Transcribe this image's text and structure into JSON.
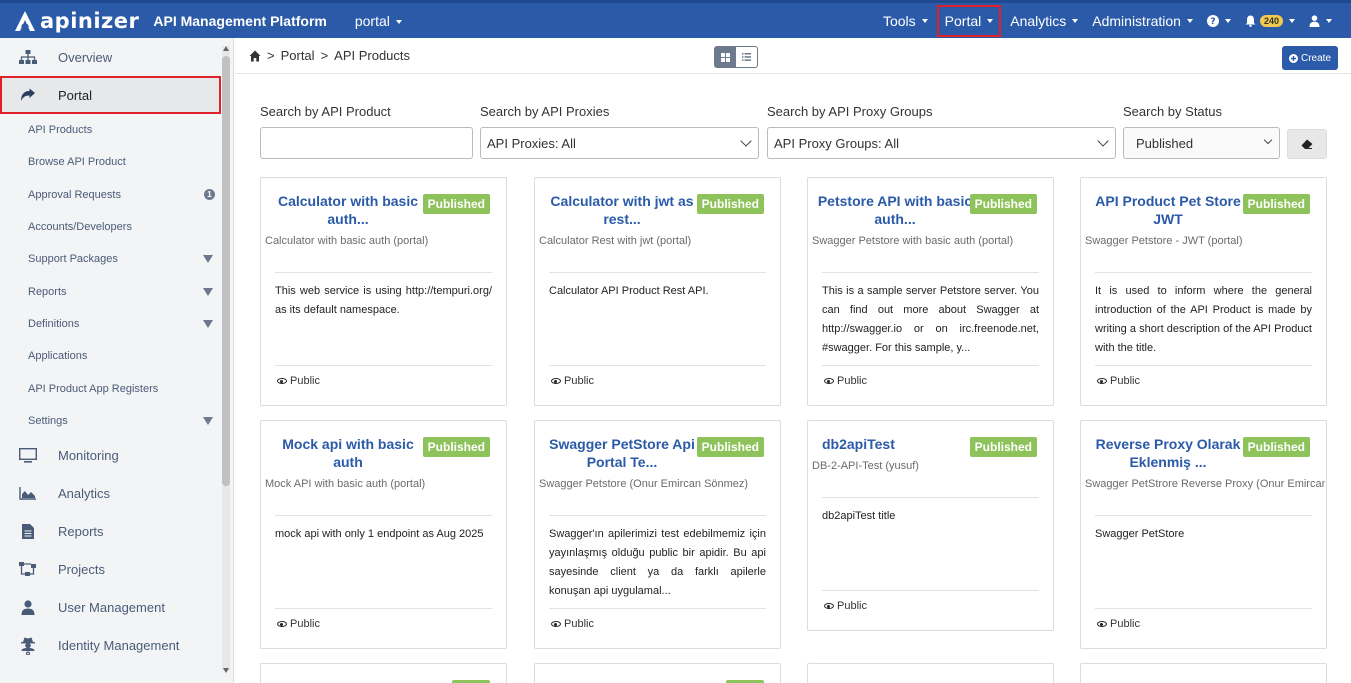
{
  "header": {
    "logo_text": "apinizer",
    "platform_title": "API Management Platform",
    "project_select": "portal",
    "nav": [
      {
        "label": "Tools"
      },
      {
        "label": "Portal"
      },
      {
        "label": "Analytics"
      },
      {
        "label": "Administration"
      }
    ],
    "notification_count": "240"
  },
  "sidebar": {
    "main_top": [
      {
        "label": "Overview",
        "icon": "sitemap-icon"
      },
      {
        "label": "Portal",
        "icon": "share-arrow-icon"
      }
    ],
    "portal_sub": [
      {
        "label": "API Products"
      },
      {
        "label": "Browse API Product"
      },
      {
        "label": "Approval Requests",
        "count": "1"
      },
      {
        "label": "Accounts/Developers"
      },
      {
        "label": "Support Packages",
        "expandable": true
      },
      {
        "label": "Reports",
        "expandable": true
      },
      {
        "label": "Definitions",
        "expandable": true
      },
      {
        "label": "Applications"
      },
      {
        "label": "API Product App Registers"
      },
      {
        "label": "Settings",
        "expandable": true
      }
    ],
    "main_bottom": [
      {
        "label": "Monitoring",
        "icon": "monitor-icon"
      },
      {
        "label": "Analytics",
        "icon": "area-chart-icon"
      },
      {
        "label": "Reports",
        "icon": "document-icon"
      },
      {
        "label": "Projects",
        "icon": "project-tree-icon"
      },
      {
        "label": "User Management",
        "icon": "user-icon"
      },
      {
        "label": "Identity Management",
        "icon": "user-secret-icon"
      }
    ]
  },
  "breadcrumb": {
    "items": [
      "Portal",
      "API Products"
    ],
    "separator": ">"
  },
  "toolbar": {
    "create_label": "Create"
  },
  "filters": {
    "product_label": "Search by API Product",
    "product_value": "",
    "proxies_label": "Search by API Proxies",
    "proxies_value": "API Proxies: All",
    "groups_label": "Search by API Proxy Groups",
    "groups_value": "API Proxy Groups: All",
    "status_label": "Search by Status",
    "status_value": "Published"
  },
  "cards": [
    {
      "title": "Calculator with basic auth...",
      "status": "Published",
      "subtitle": "Calculator with basic auth (portal)",
      "description": "This web service is using http://tempuri.org/ as its default namespace.",
      "visibility": "Public"
    },
    {
      "title": "Calculator with jwt as rest...",
      "status": "Published",
      "subtitle": "Calculator Rest with jwt (portal)",
      "description": "Calculator API Product Rest API.",
      "visibility": "Public"
    },
    {
      "title": "Petstore API with basic auth...",
      "status": "Published",
      "subtitle": "Swagger Petstore with basic auth (portal)",
      "description": "This is a sample server Petstore server. You can find out more about Swagger at http://swagger.io or on irc.freenode.net, #swagger. For this sample, y...",
      "visibility": "Public"
    },
    {
      "title": "API Product Pet Store JWT",
      "status": "Published",
      "subtitle": "Swagger Petstore - JWT (portal)",
      "description": "It is used to inform where the general introduction of the API Product is made by writing a short description of the API Product with the title.",
      "visibility": "Public"
    },
    {
      "title": "Mock api with basic auth",
      "status": "Published",
      "subtitle": "Mock API with basic auth (portal)",
      "description": "mock api with only 1 endpoint as Aug 2025",
      "visibility": "Public"
    },
    {
      "title": "Swagger PetStore Api Portal Te...",
      "status": "Published",
      "subtitle": "Swagger Petstore (Onur Emircan Sönmez)",
      "description": "Swagger'ın apilerimizi test edebilmemiz için yayınlaşmış olduğu public bir apidir. Bu api sayesinde client ya da farklı apilerle konuşan api uygulamal...",
      "visibility": "Public"
    },
    {
      "title": "db2apiTest",
      "status": "Published",
      "subtitle": "DB-2-API-Test (yusuf)",
      "description": "db2apiTest title",
      "visibility": "Public"
    },
    {
      "title": "Reverse Proxy Olarak Eklenmiş ...",
      "status": "Published",
      "subtitle": "Swagger PetStrore Reverse Proxy (Onur Emircan S",
      "description": "Swagger PetStore",
      "visibility": "Public"
    }
  ]
}
